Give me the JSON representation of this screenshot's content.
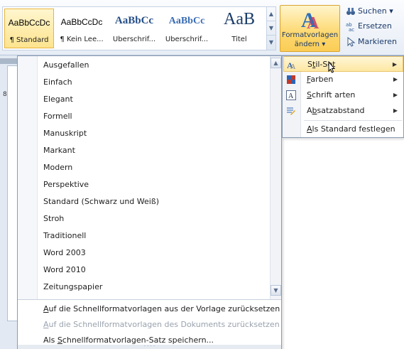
{
  "gallery": {
    "tiles": [
      {
        "sample": "AaBbCcDc",
        "name": "¶ Standard",
        "selected": true
      },
      {
        "sample": "AaBbCcDc",
        "name": "¶ Kein Lee...",
        "selected": false
      },
      {
        "sample": "AaBbCc",
        "name": "Überschrif...",
        "selected": false
      },
      {
        "sample": "AaBbCc",
        "name": "Überschrif...",
        "selected": false
      },
      {
        "sample": "AaB",
        "name": "Titel",
        "selected": false
      }
    ]
  },
  "change_styles_button": {
    "line1": "Formatvorlagen",
    "line2": "ändern ▾"
  },
  "editing": {
    "find": "Suchen ▾",
    "replace": "Ersetzen",
    "select": "Markieren"
  },
  "ruler": {
    "marker": "8"
  },
  "style_sets": {
    "items": [
      "Ausgefallen",
      "Einfach",
      "Elegant",
      "Formell",
      "Manuskript",
      "Markant",
      "Modern",
      "Perspektive",
      "Standard (Schwarz und Weiß)",
      "Stroh",
      "Traditionell",
      "Word 2003",
      "Word 2010",
      "Zeitungspapier"
    ],
    "commands": {
      "reset_template": {
        "mn": "A",
        "rest": "uf die Schnellformatvorlagen aus der Vorlage zurücksetzen"
      },
      "reset_document": {
        "mn": "A",
        "rest": "uf die Schnellformatvorlagen des Dokuments zurücksetzen"
      },
      "save_as": {
        "pre": "Als ",
        "mn": "S",
        "rest": "chnellformatvorlagen-Satz speichern..."
      }
    }
  },
  "change_styles_menu": {
    "items": [
      {
        "pre": "S",
        "mn": "t",
        "rest": "il-Set"
      },
      {
        "pre": "",
        "mn": "F",
        "rest": "arben"
      },
      {
        "pre": "",
        "mn": "S",
        "rest": "chrift arten"
      },
      {
        "pre": "A",
        "mn": "b",
        "rest": "satzabstand"
      },
      {
        "pre": "",
        "mn": "A",
        "rest": "ls Standard festlegen"
      }
    ]
  },
  "colors": {
    "accent_orange": "#fde48e",
    "ribbon_blue": "#e7edf6",
    "menu_border": "#8a9cb5"
  }
}
